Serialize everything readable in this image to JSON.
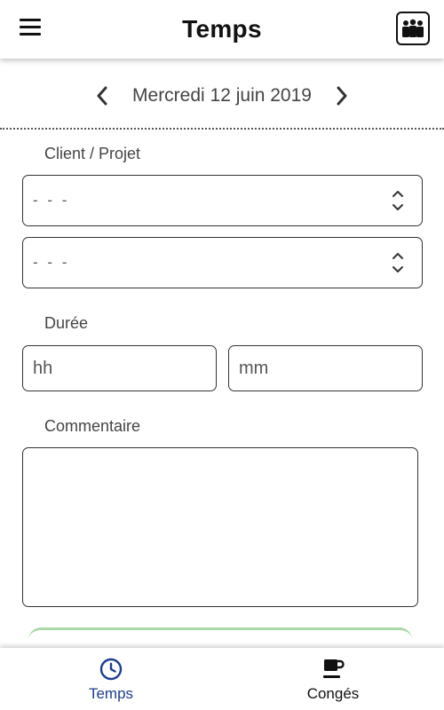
{
  "header": {
    "title": "Temps",
    "menu_icon": "hamburger-menu-icon",
    "logo_icon": "team-logo-icon"
  },
  "date_nav": {
    "date": "Mercredi 12 juin 2019",
    "prev_icon": "chevron-left-icon",
    "next_icon": "chevron-right-icon"
  },
  "form": {
    "client_label": "Client / Projet",
    "client_select": {
      "value": "- - -"
    },
    "project_select": {
      "value": "- - -"
    },
    "duration_label": "Durée",
    "hours": {
      "placeholder": "hh",
      "value": ""
    },
    "minutes": {
      "placeholder": "mm",
      "value": ""
    },
    "comment_label": "Commentaire",
    "comment": {
      "value": ""
    }
  },
  "bottom_nav": {
    "tabs": [
      {
        "label": "Temps",
        "icon": "clock-icon",
        "active": true
      },
      {
        "label": "Congés",
        "icon": "coffee-cup-icon",
        "active": false
      }
    ]
  },
  "colors": {
    "active_tab": "#1c3b94",
    "submit_button_edge": "#a9d9a6",
    "text": "#444444"
  }
}
